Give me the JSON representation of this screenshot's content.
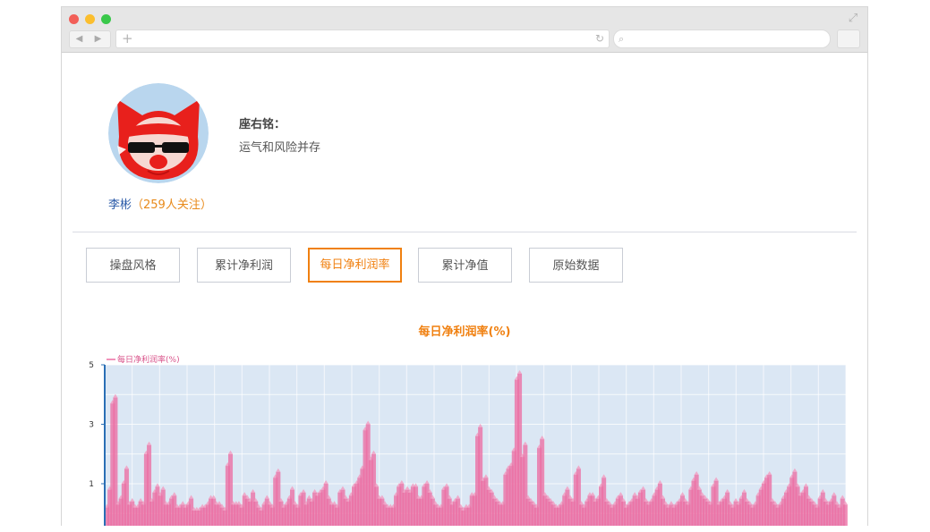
{
  "profile": {
    "name": "李彬",
    "followers": "（259人关注）",
    "motto_label": "座右铭：",
    "motto": "运气和风险并存"
  },
  "tabs": [
    {
      "label": "操盘风格",
      "active": false
    },
    {
      "label": "累计净利润",
      "active": false
    },
    {
      "label": "每日净利润率",
      "active": true
    },
    {
      "label": "累计净值",
      "active": false
    },
    {
      "label": "原始数据",
      "active": false
    }
  ],
  "chart_data": {
    "type": "bar",
    "title": "每日净利润率(%)",
    "legend": "每日净利润率(%)",
    "legend_position": "top-left",
    "y_ticks": [
      "5",
      "3",
      "1"
    ],
    "ylim": [
      -0.3,
      5
    ],
    "grid": true,
    "colors": {
      "bar": "#ec6ea3",
      "plot_bg": "#dbe7f4",
      "axis": "#2a6fb5"
    },
    "values": [
      0.2,
      0.8,
      3.7,
      3.9,
      0.3,
      0.5,
      1.0,
      1.5,
      0.3,
      0.4,
      0.2,
      0.2,
      0.4,
      0.3,
      2.0,
      2.3,
      0.4,
      0.7,
      0.9,
      0.6,
      0.8,
      0.3,
      0.3,
      0.5,
      0.6,
      0.2,
      0.2,
      0.3,
      0.2,
      0.3,
      0.5,
      0.1,
      0.1,
      0.1,
      0.2,
      0.2,
      0.3,
      0.5,
      0.5,
      0.3,
      0.3,
      0.2,
      0.1,
      1.6,
      2.0,
      0.3,
      0.3,
      0.3,
      0.2,
      0.6,
      0.5,
      0.4,
      0.7,
      0.4,
      0.2,
      0.1,
      0.3,
      0.5,
      0.3,
      0.2,
      1.2,
      1.4,
      0.4,
      0.2,
      0.3,
      0.5,
      0.8,
      0.3,
      0.2,
      0.6,
      0.7,
      0.3,
      0.5,
      0.4,
      0.7,
      0.6,
      0.7,
      0.8,
      1.0,
      0.5,
      0.3,
      0.3,
      0.2,
      0.7,
      0.8,
      0.5,
      0.4,
      0.6,
      0.9,
      1.0,
      1.2,
      1.5,
      2.8,
      3.0,
      1.8,
      2.0,
      0.9,
      0.5,
      0.5,
      0.3,
      0.2,
      0.2,
      0.2,
      0.6,
      0.9,
      1.0,
      0.7,
      0.8,
      0.7,
      0.9,
      0.9,
      0.5,
      0.5,
      0.9,
      1.0,
      0.7,
      0.5,
      0.3,
      0.2,
      0.2,
      0.8,
      0.9,
      0.5,
      0.3,
      0.4,
      0.5,
      0.2,
      0.1,
      0.2,
      0.2,
      0.6,
      0.6,
      2.6,
      2.9,
      1.1,
      1.2,
      0.8,
      0.7,
      0.5,
      0.4,
      0.3,
      0.3,
      1.3,
      1.5,
      1.6,
      2.1,
      4.5,
      4.7,
      1.9,
      2.3,
      0.5,
      0.4,
      0.3,
      0.2,
      2.2,
      2.5,
      0.6,
      0.5,
      0.4,
      0.3,
      0.2,
      0.2,
      0.3,
      0.6,
      0.8,
      0.5,
      0.4,
      1.3,
      1.5,
      0.3,
      0.2,
      0.4,
      0.6,
      0.6,
      0.4,
      0.5,
      0.9,
      1.2,
      0.4,
      0.3,
      0.2,
      0.3,
      0.5,
      0.6,
      0.4,
      0.2,
      0.3,
      0.4,
      0.6,
      0.5,
      0.7,
      0.8,
      0.4,
      0.3,
      0.4,
      0.6,
      0.8,
      1.0,
      0.5,
      0.3,
      0.2,
      0.3,
      0.2,
      0.3,
      0.4,
      0.6,
      0.4,
      0.3,
      0.8,
      1.1,
      1.3,
      0.8,
      0.6,
      0.5,
      0.4,
      0.3,
      0.9,
      1.1,
      0.3,
      0.4,
      0.5,
      0.7,
      0.3,
      0.2,
      0.4,
      0.3,
      0.5,
      0.7,
      0.4,
      0.3,
      0.2,
      0.3,
      0.6,
      0.8,
      1.0,
      1.2,
      1.3,
      0.4,
      0.3,
      0.2,
      0.3,
      0.5,
      0.7,
      0.9,
      1.2,
      1.4,
      0.9,
      0.6,
      0.7,
      0.9,
      0.5,
      0.4,
      0.3,
      0.2,
      0.5,
      0.7,
      0.4,
      0.3,
      0.4,
      0.6,
      0.3,
      0.2,
      0.5,
      0.3
    ]
  }
}
